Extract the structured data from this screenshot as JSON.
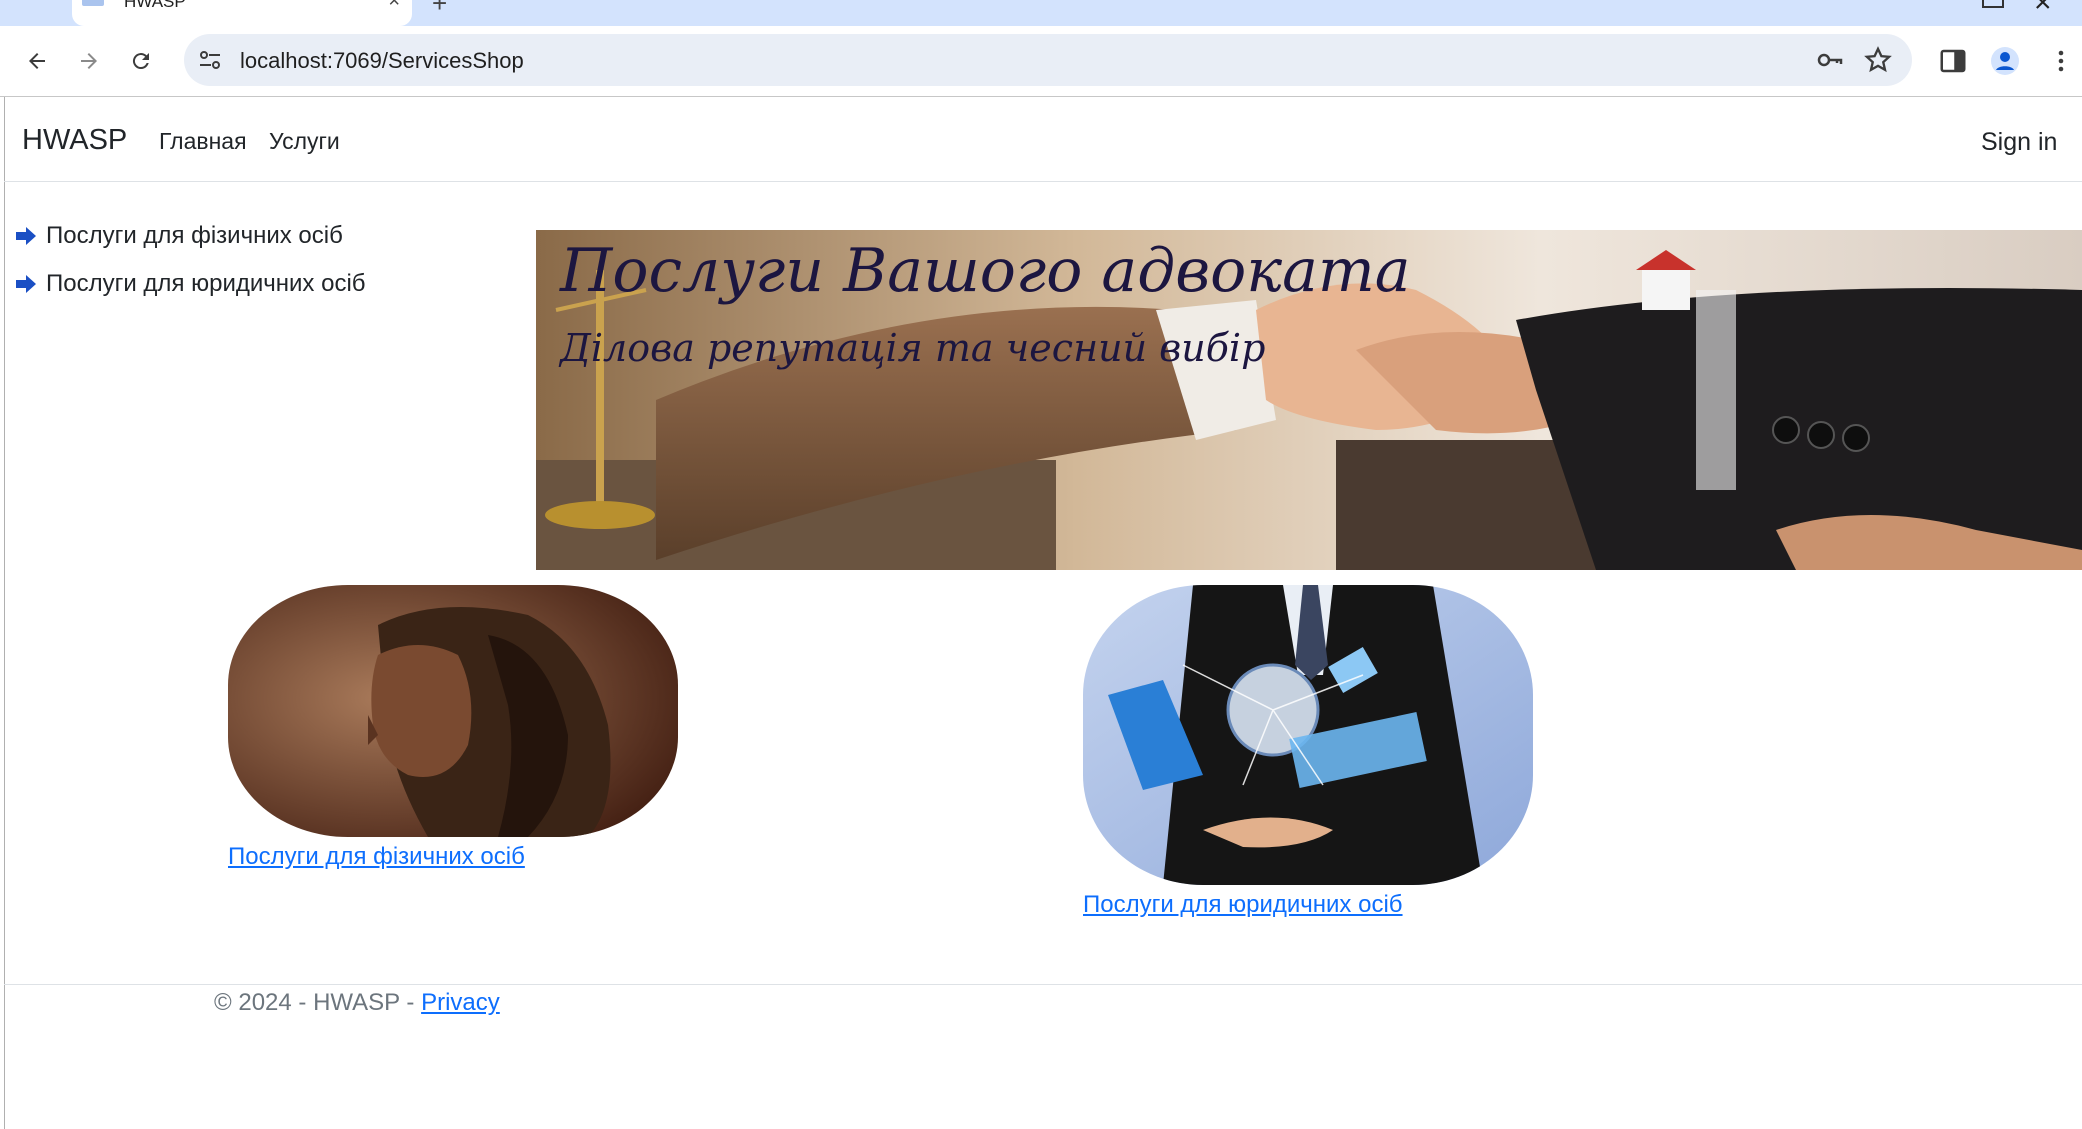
{
  "browser": {
    "tab_title": "HWASP",
    "url": "localhost:7069/ServicesShop"
  },
  "site": {
    "brand": "HWASP",
    "nav": [
      {
        "label": "Главная"
      },
      {
        "label": "Услуги"
      }
    ],
    "sign_in": "Sign in"
  },
  "sidebar": {
    "items": [
      {
        "label": "Послуги для фізичних осіб"
      },
      {
        "label": "Послуги для юридичних осіб"
      }
    ]
  },
  "banner": {
    "title": "Послуги Вашого адвоката",
    "subtitle": "Ділова репутація та чесний вибір"
  },
  "cards": [
    {
      "link": "Послуги для фізичних осіб"
    },
    {
      "link": "Послуги для юридичних осіб"
    }
  ],
  "footer": {
    "copyright": "© 2024 - HWASP - ",
    "privacy": "Privacy"
  },
  "colors": {
    "link": "#0d6efd",
    "arrow": "#1a4fc4",
    "tabstrip": "#d3e3fd"
  }
}
